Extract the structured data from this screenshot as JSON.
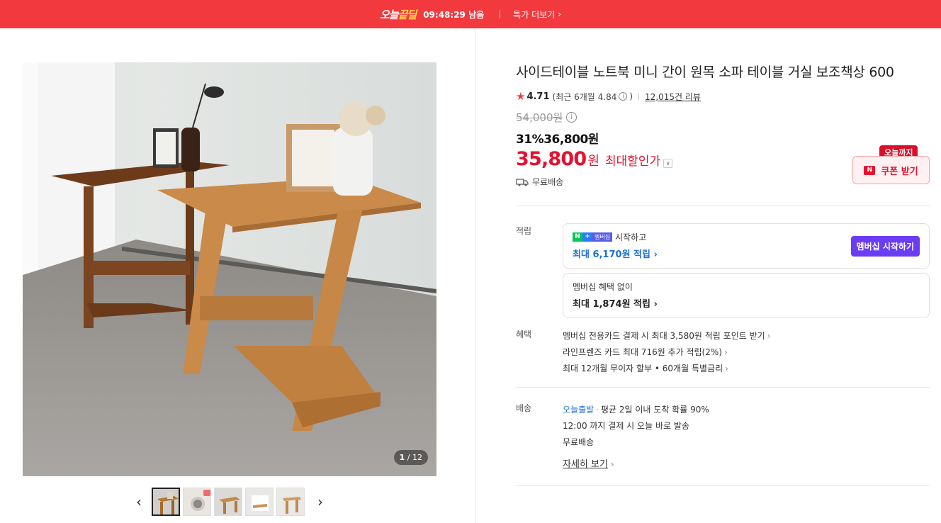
{
  "topbar": {
    "brand_a": "오늘",
    "brand_b": "끝딜",
    "timer": "09:48:29 남음",
    "more_label": "특가 더보기",
    "color": "#f2393e"
  },
  "gallery": {
    "counter_current": "1",
    "counter_total": "/ 12",
    "prev_icon": "chevron-left-icon",
    "next_icon": "chevron-right-icon"
  },
  "product": {
    "title": "사이드테이블 노트북 미니 간이 원목 소파 테이블 거실 보조책상 600",
    "rating": "4.71",
    "recent_rating": "(최근 6개월 4.84",
    "recent_close": ")",
    "review_count": "12,015건 리뷰",
    "original_price": "54,000원",
    "discount_line": "31%36,800원",
    "final_price": "35,800",
    "final_won": "원",
    "max_discount": "최대할인가",
    "shipping": "무료배송",
    "accent": "#e8102e"
  },
  "coupon": {
    "tag": "오늘까지",
    "label": "쿠폰 받기"
  },
  "points": {
    "label": "적립",
    "member_badge": "멤버십",
    "member_start": "시작하고",
    "member_max": "최대 6,170원 적립",
    "start_button": "멤버십 시작하기",
    "no_member": "멤버십 혜택 없이",
    "no_member_max": "최대 1,874원 적립"
  },
  "benefits": {
    "label": "혜택",
    "items": [
      "멤버십 전용카드 결제 시 최대 3,580원 적립 포인트 받기",
      "라인프렌즈 카드 최대 716원 추가 적립(2%)",
      "최대 12개월 무이자 할부 • 60개월 특별금리"
    ]
  },
  "delivery": {
    "label": "배송",
    "today": "오늘출발",
    "prob": "평균 2일 이내 도착 확률 90%",
    "cutoff": "12:00 까지 결제 시 오늘 바로 발송",
    "free": "무료배송",
    "detail_link": "자세히 보기"
  }
}
